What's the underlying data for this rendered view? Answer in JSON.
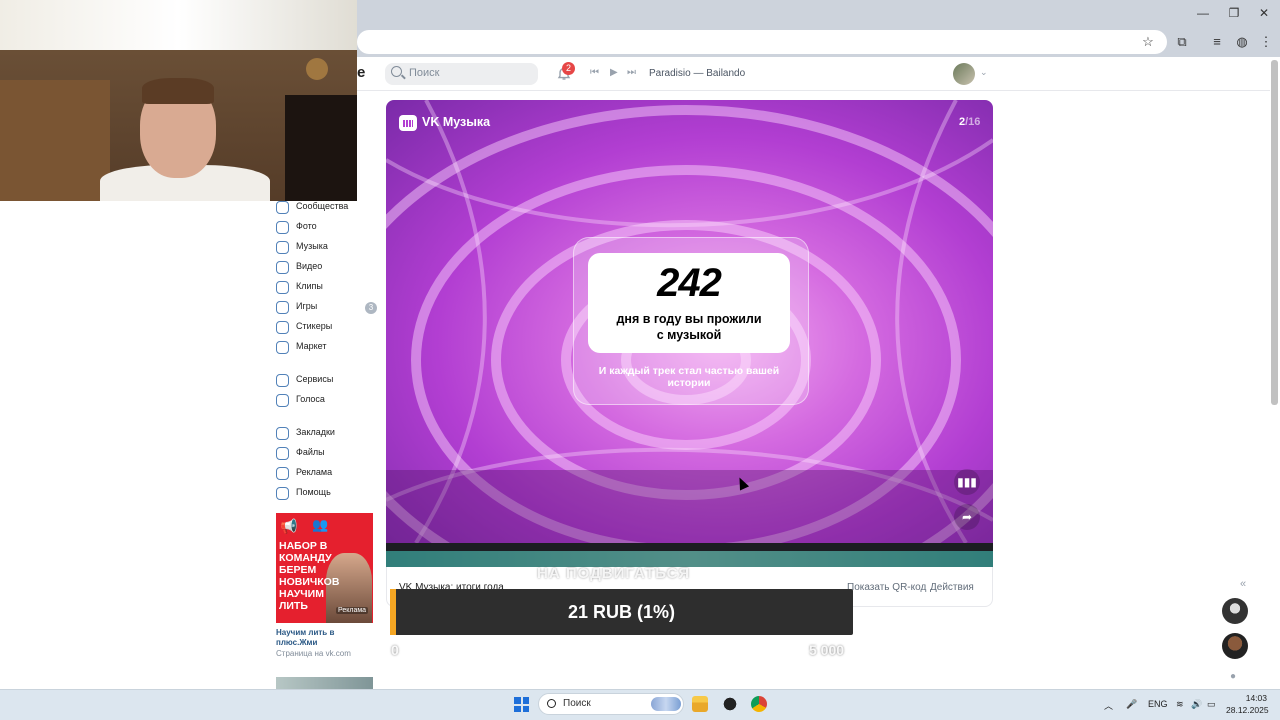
{
  "header": {
    "logo_fragment": "e",
    "search_placeholder": "Поиск",
    "notifications_count": "2",
    "now_playing": "Paradisio — Bailando"
  },
  "sidebar": {
    "items": [
      {
        "label": "Сообщества",
        "icon": "people-icon"
      },
      {
        "label": "Фото",
        "icon": "photo-icon"
      },
      {
        "label": "Музыка",
        "icon": "music-icon"
      },
      {
        "label": "Видео",
        "icon": "video-icon"
      },
      {
        "label": "Клипы",
        "icon": "clips-icon"
      },
      {
        "label": "Игры",
        "icon": "gamepad-icon",
        "count": "3"
      },
      {
        "label": "Стикеры",
        "icon": "sticker-icon"
      },
      {
        "label": "Маркет",
        "icon": "bag-icon"
      },
      {
        "label": "Сервисы",
        "icon": "grid-icon"
      },
      {
        "label": "Голоса",
        "icon": "coin-icon"
      },
      {
        "label": "Закладки",
        "icon": "bookmark-icon"
      },
      {
        "label": "Файлы",
        "icon": "file-icon"
      },
      {
        "label": "Реклама",
        "icon": "megaphone-icon"
      },
      {
        "label": "Помощь",
        "icon": "help-icon"
      }
    ]
  },
  "ad": {
    "headline": "НАБОР В КОМАНДУ БЕРЕМ НОВИЧКОВ НАУЧИМ ЛИТЬ",
    "badge": "Реклама",
    "title": "Научим лить в плюс.Жми",
    "source": "Страница на vk.com"
  },
  "story": {
    "brand": "VK Музыка",
    "counter_current": "2",
    "counter_total": "/16",
    "stat_number": "242",
    "stat_label_line1": "дня в году вы прожили",
    "stat_label_line2": "с музыкой",
    "stat_sub": "И каждый трек стал частью вашей истории",
    "caption": "VK Музыка: итоги года",
    "qr_link": "Показать QR-код",
    "actions_link": "Действия",
    "accent_color": "#b23ed2"
  },
  "donation": {
    "heading": "НА ПОДВИГАТЬСЯ",
    "amount": "21 RUB (1%)",
    "progress": 0.01,
    "min": "0",
    "max": "5 000",
    "fill_color": "#f5a623"
  },
  "taskbar": {
    "search_label": "Поиск",
    "language": "ENG",
    "time": "14:03",
    "date": "28.12.2025"
  }
}
